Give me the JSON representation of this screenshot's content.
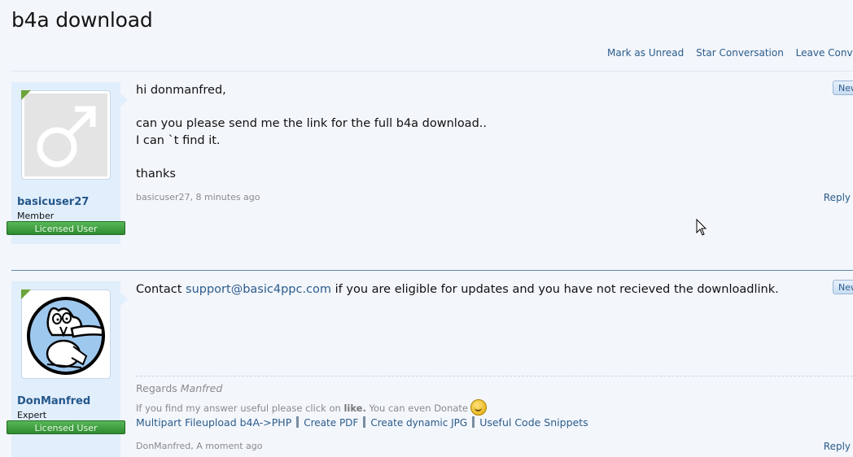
{
  "thread": {
    "title": "b4a download",
    "actions": [
      "Mark as Unread",
      "Star Conversation",
      "Leave Conversatio"
    ]
  },
  "messages": [
    {
      "username": "basicuser27",
      "user_title": "Member",
      "badge": "Licensed User",
      "avatar": "default-male-avatar-icon",
      "lines": [
        "hi donmanfred,",
        "",
        "can you please send me the link for the full b4a download..",
        "I can `t find it.",
        "",
        "thanks"
      ],
      "meta": "basicuser27, 8 minutes ago",
      "reply_label": "Reply",
      "new_label": "New"
    },
    {
      "username": "DonManfred",
      "user_title": "Expert",
      "badge": "Licensed User",
      "avatar": "cat-cartoon-avatar-icon",
      "text_before": "Contact ",
      "email": "support@basic4ppc.com",
      "text_after": " if you are eligible for updates and you have not recieved the downloadlink.",
      "signature": {
        "regards_prefix": "Regards ",
        "regards_name": "Manfred",
        "useful_prefix": "If you find my answer useful please click on ",
        "useful_bold": "like.",
        "useful_suffix": " You can even Donate",
        "links": [
          "Multipart Fileupload b4A->PHP",
          "Create PDF",
          "Create dynamic JPG",
          "Useful Code Snippets"
        ]
      },
      "meta": "DonManfred, A moment ago",
      "reply_label": "Reply",
      "new_label": "New"
    }
  ],
  "colors": {
    "link": "#2b5c8c",
    "badge": "#3a9a3a",
    "user_panel": "#e1eefc",
    "divider": "#5c85ad"
  }
}
